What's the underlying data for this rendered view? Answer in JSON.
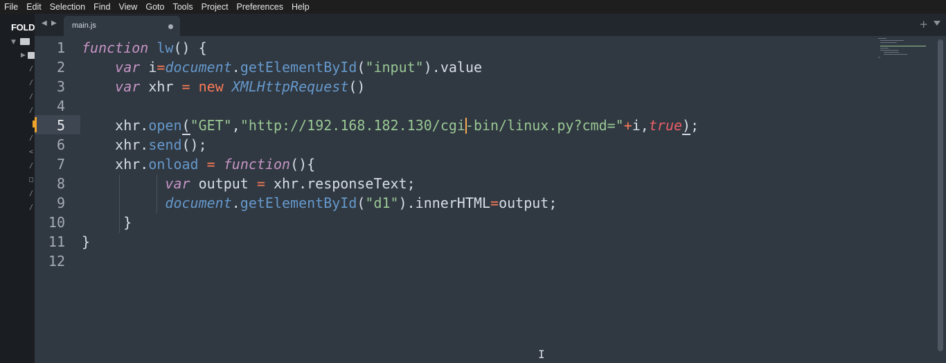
{
  "menu": [
    "File",
    "Edit",
    "Selection",
    "Find",
    "View",
    "Goto",
    "Tools",
    "Project",
    "Preferences",
    "Help"
  ],
  "sidebar": {
    "title": "FOLD",
    "files": [
      "/",
      "/",
      "/",
      "/",
      "/",
      "/",
      "<",
      "/",
      "□",
      "/",
      "/"
    ]
  },
  "tabs": [
    {
      "label": "main.js",
      "dirty": true
    }
  ],
  "gutter": [
    "1",
    "2",
    "3",
    "4",
    "5",
    "6",
    "7",
    "8",
    "9",
    "10",
    "11",
    "12"
  ],
  "active_line": 5,
  "code": {
    "l1": {
      "a": "function",
      "b": " ",
      "c": "lw",
      "d": "() {"
    },
    "l2": {
      "a": "var",
      "b": " i",
      "c": "=",
      "d": "document",
      "e": ".",
      "f": "getElementById",
      "g": "(",
      "h": "\"input\"",
      "i": ").value"
    },
    "l3": {
      "a": "var",
      "b": " xhr ",
      "c": "=",
      "d": " ",
      "e": "new",
      "f": " ",
      "g": "XMLHttpRequest",
      "h": "()"
    },
    "l4": {},
    "l5": {
      "a": "xhr.",
      "b": "open",
      "c": "(",
      "d": "\"GET\"",
      "e": ",",
      "f": "\"http://192.168.182.130/cgi-bin/linux.py?cmd=\"",
      "g": "+",
      "h": "i,",
      "i": "true",
      "j": ")",
      ";": ";"
    },
    "l6": {
      "a": "xhr.",
      "b": "send",
      "c": "();"
    },
    "l7": {
      "a": "xhr.",
      "b": "onload",
      "c": " ",
      "d": "=",
      "e": " ",
      "f": "function",
      "g": "(){"
    },
    "l8": {
      "a": "var",
      "b": " output ",
      "c": "=",
      "d": " xhr.responseText;"
    },
    "l9": {
      "a": "document",
      "b": ".",
      "c": "getElementById",
      "d": "(",
      "e": "\"d1\"",
      "f": ").innerHTML",
      "g": "=",
      "h": "output;"
    },
    "l10": {
      "a": "}"
    },
    "l11": {
      "a": "}"
    }
  },
  "colors": {
    "background": "#303841",
    "keyword": "#c695c6",
    "function": "#6699cc",
    "string": "#99c794",
    "operator": "#f97b58",
    "boolean": "#ec5f67",
    "caret": "#f9ae58"
  }
}
